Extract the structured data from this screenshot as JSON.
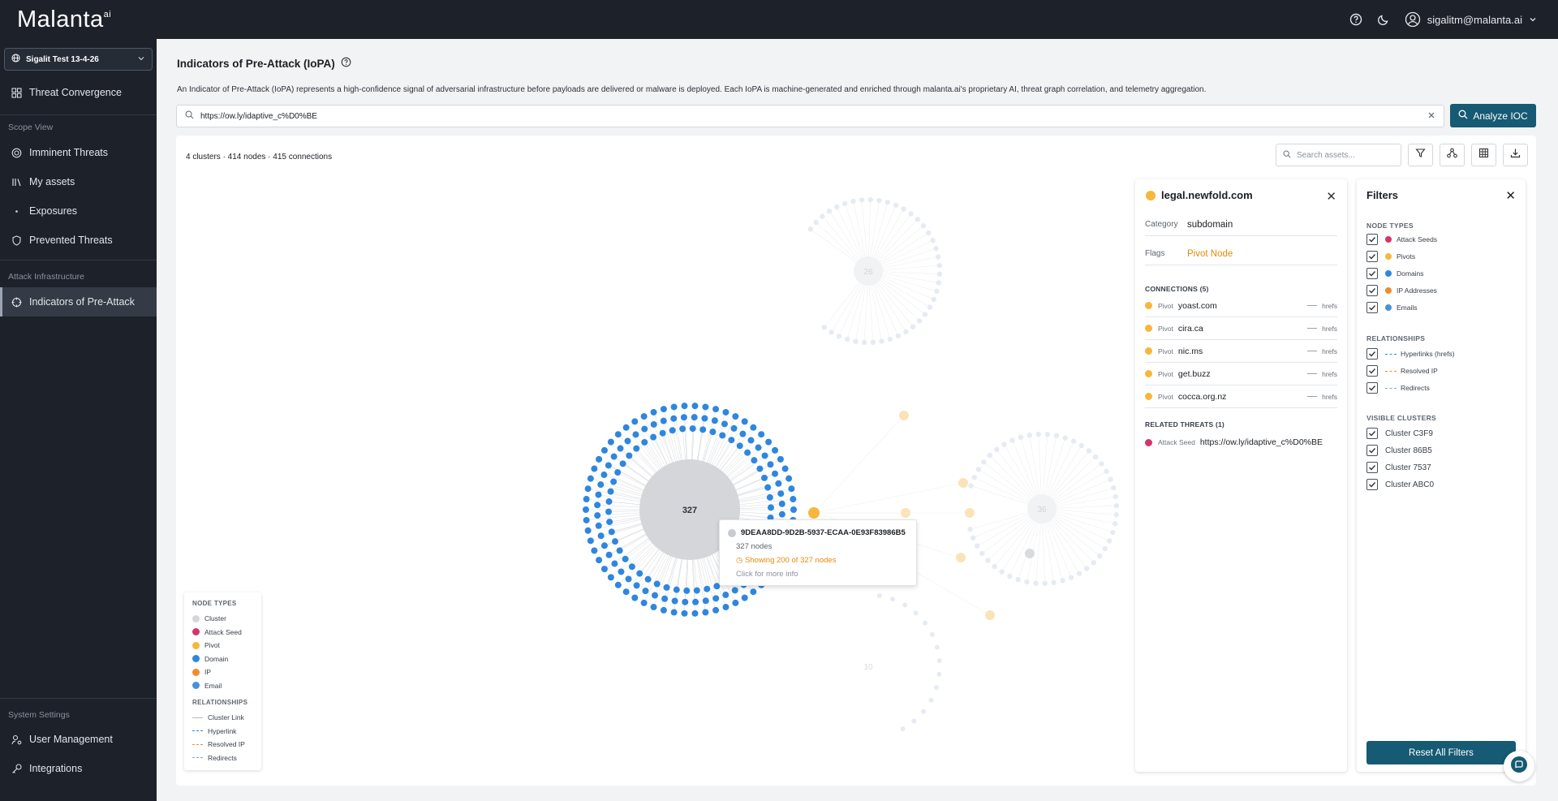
{
  "app": {
    "logo": "Malanta",
    "logo_suffix": "ai"
  },
  "topbar": {
    "user_email": "sigalitm@malanta.ai"
  },
  "sidebar": {
    "org": "Sigalit Test 13-4-26",
    "items": [
      {
        "label": "Threat Convergence"
      },
      {
        "label": "Imminent Threats"
      },
      {
        "label": "My assets"
      },
      {
        "label": "Exposures"
      },
      {
        "label": "Prevented Threats"
      },
      {
        "label": "Indicators of Pre-Attack"
      },
      {
        "label": "User Management"
      },
      {
        "label": "Integrations"
      }
    ],
    "sections": {
      "scope": "Scope View",
      "attack": "Attack Infrastructure",
      "system": "System Settings"
    }
  },
  "page": {
    "title": "Indicators of Pre-Attack (IoPA)",
    "description": "An Indicator of Pre-Attack (IoPA) represents a high-confidence signal of adversarial infrastructure before payloads are delivered or malware is deployed. Each IoPA is machine-generated and enriched through malanta.ai's proprietary AI, threat graph correlation, and telemetry aggregation.",
    "search_value": "https://ow.ly/idaptive_c%D0%BE",
    "analyze_label": "Analyze IOC"
  },
  "graph": {
    "stats": "4 clusters · 414 nodes · 415 connections",
    "asset_search_placeholder": "Search assets...",
    "main_cluster_label": "327",
    "cluster_b_label": "26",
    "cluster_c_label": "36",
    "cluster_d_label": "10",
    "colors": {
      "cluster": "#d4d6da",
      "seed": "#d6336c",
      "pivot": "#f6b73c",
      "domain": "#2f86de",
      "ip": "#f28b2c",
      "email": "#4a90d9"
    }
  },
  "legend": {
    "node_types_title": "NODE TYPES",
    "node_types": [
      "Cluster",
      "Attack Seed",
      "Pivot",
      "Domain",
      "IP",
      "Email"
    ],
    "relationships_title": "RELATIONSHIPS",
    "relationships": [
      "Cluster Link",
      "Hyperlink",
      "Resolved IP",
      "Redirects"
    ]
  },
  "tooltip": {
    "title": "9DEAA8DD-9D2B-5937-ECAA-0E93F83986B5",
    "nodes": "327 nodes",
    "showing": "Showing 200 of 327 nodes",
    "hint": "Click for more info"
  },
  "detail": {
    "title": "legal.newfold.com",
    "category_key": "Category",
    "category_value": "subdomain",
    "flags_key": "Flags",
    "flags_value": "Pivot Node",
    "connections_title": "CONNECTIONS (5)",
    "connections": [
      {
        "type": "Pivot",
        "name": "yoast.com",
        "rel": "hrefs"
      },
      {
        "type": "Pivot",
        "name": "cira.ca",
        "rel": "hrefs"
      },
      {
        "type": "Pivot",
        "name": "nic.ms",
        "rel": "hrefs"
      },
      {
        "type": "Pivot",
        "name": "get.buzz",
        "rel": "hrefs"
      },
      {
        "type": "Pivot",
        "name": "cocca.org.nz",
        "rel": "hrefs"
      }
    ],
    "related_title": "RELATED THREATS (1)",
    "related": [
      {
        "type": "Attack Seed",
        "name": "https://ow.ly/idaptive_c%D0%BE"
      }
    ]
  },
  "filters": {
    "title": "Filters",
    "node_types_title": "NODE TYPES",
    "node_types": [
      "Attack Seeds",
      "Pivots",
      "Domains",
      "IP Addresses",
      "Emails"
    ],
    "relationships_title": "RELATIONSHIPS",
    "relationships": [
      "Hyperlinks (hrefs)",
      "Resolved IP",
      "Redirects"
    ],
    "clusters_title": "VISIBLE CLUSTERS",
    "clusters": [
      "Cluster C3F9",
      "Cluster 86B5",
      "Cluster 7537",
      "Cluster ABC0"
    ],
    "reset_label": "Reset All Filters"
  }
}
